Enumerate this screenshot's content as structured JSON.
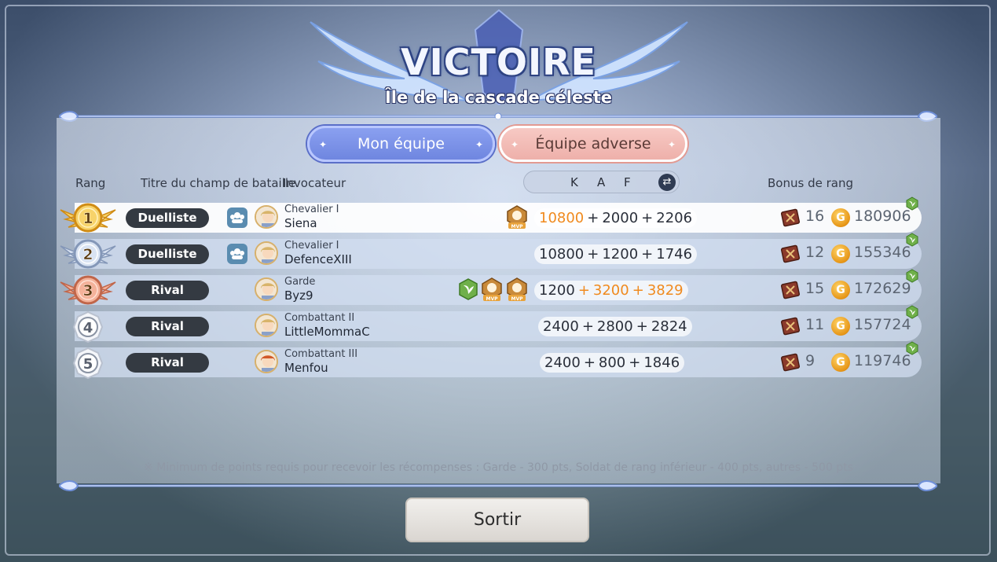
{
  "header": {
    "title": "VICTOIRE",
    "subtitle": "Île de la cascade céleste"
  },
  "tabs": {
    "mine": "Mon équipe",
    "enemy": "Équipe adverse"
  },
  "columns": {
    "rank": "Rang",
    "battle_title": "Titre du champ de bataille",
    "summoner": "Invocateur",
    "k": "K",
    "a": "A",
    "f": "F",
    "rank_bonus": "Bonus de rang"
  },
  "rows": [
    {
      "rank": "1",
      "title": "Duelliste",
      "rank_name": "Chevalier I",
      "player": "Siena",
      "k": "10800",
      "a": "2000",
      "f": "2206",
      "books": "16",
      "gold": "180906",
      "has_party": true,
      "mvp": [
        "mvp-kills"
      ],
      "highlight": "k"
    },
    {
      "rank": "2",
      "title": "Duelliste",
      "rank_name": "Chevalier I",
      "player": "DefenceXIII",
      "k": "10800",
      "a": "1200",
      "f": "1746",
      "books": "12",
      "gold": "155346",
      "has_party": true,
      "mvp": [],
      "highlight": ""
    },
    {
      "rank": "3",
      "title": "Rival",
      "rank_name": "Garde",
      "player": "Byz9",
      "k": "1200",
      "a": "3200",
      "f": "3829",
      "books": "15",
      "gold": "172629",
      "has_party": false,
      "mvp": [
        "leaf",
        "mvp-assist",
        "mvp-fort"
      ],
      "highlight": "af"
    },
    {
      "rank": "4",
      "title": "Rival",
      "rank_name": "Combattant II",
      "player": "LittleMommaC",
      "k": "2400",
      "a": "2800",
      "f": "2824",
      "books": "11",
      "gold": "157724",
      "has_party": false,
      "mvp": [],
      "highlight": ""
    },
    {
      "rank": "5",
      "title": "Rival",
      "rank_name": "Combattant III",
      "player": "Menfou",
      "k": "2400",
      "a": "800",
      "f": "1846",
      "books": "9",
      "gold": "119746",
      "has_party": false,
      "mvp": [],
      "highlight": ""
    }
  ],
  "plus": "+",
  "mvp_label": "MVP",
  "coin_glyph": "G",
  "footer_note": "※ Minimum de points requis pour recevoir les récompenses : Garde - 300 pts, Soldat de rang inférieur - 400 pts, autres - 500 pts",
  "exit_label": "Sortir",
  "colors": {
    "highlight": "#f08a1e",
    "tab_mine": "#7b91e8",
    "tab_enemy": "#f2bcb6",
    "pill": "#343a42"
  }
}
